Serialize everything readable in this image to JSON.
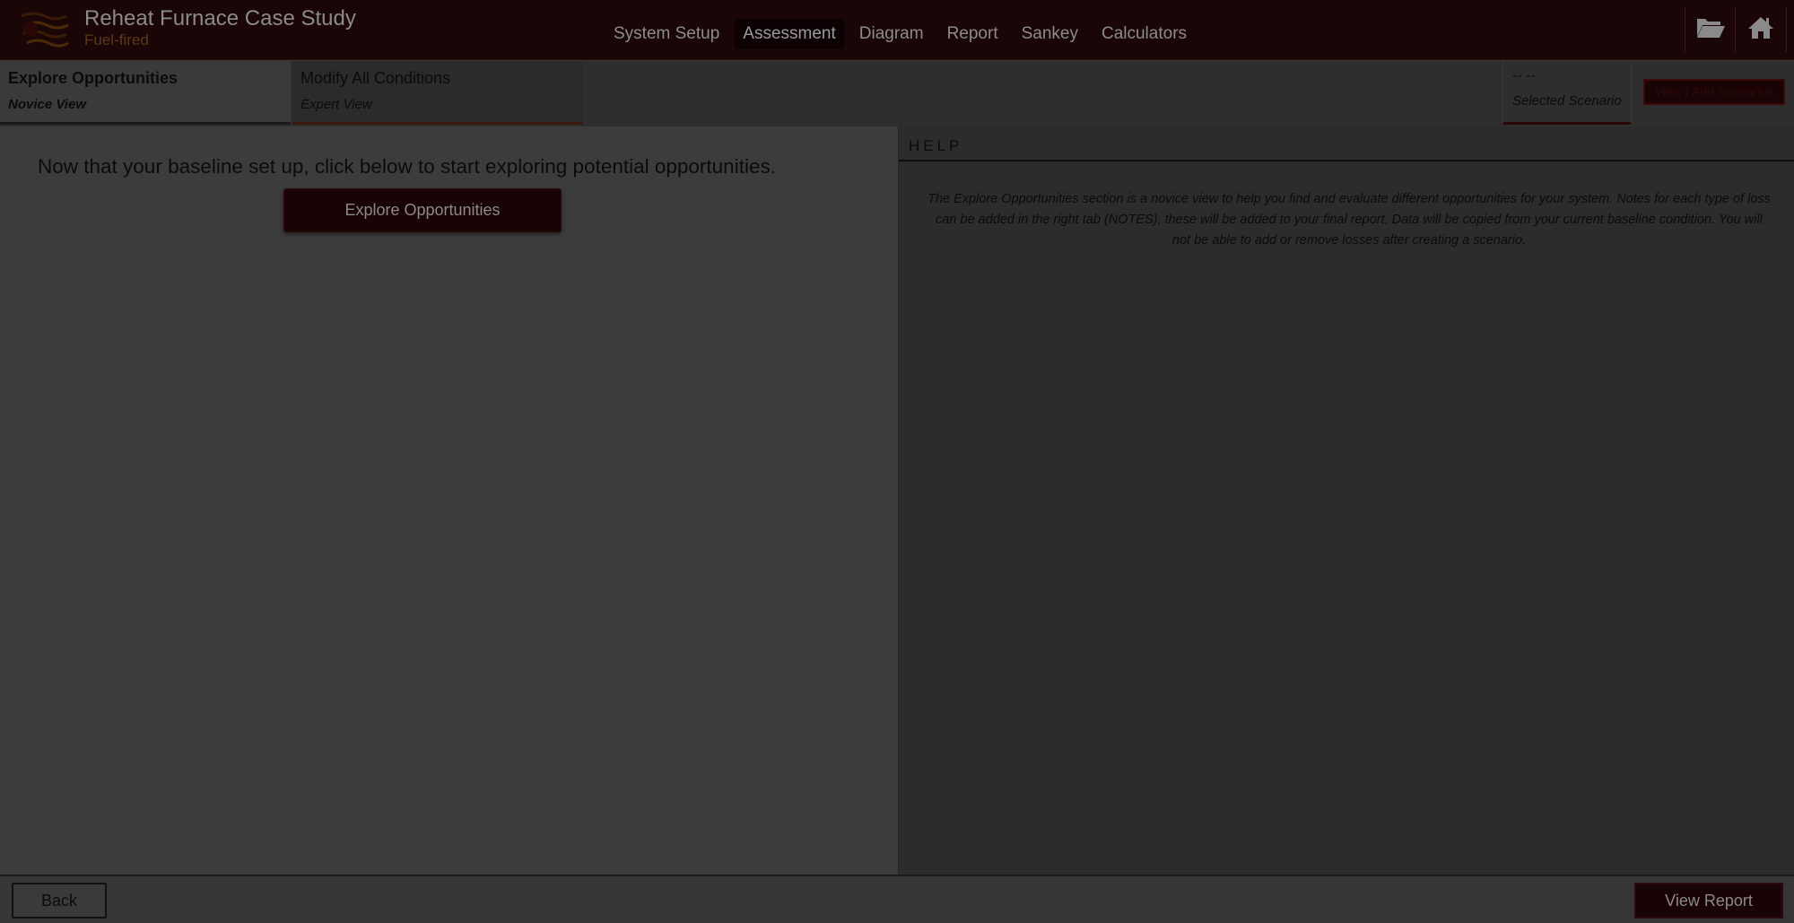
{
  "header": {
    "title": "Reheat Furnace Case Study",
    "subtitle": "Fuel-fired",
    "nav": [
      {
        "label": "System Setup"
      },
      {
        "label": "Assessment"
      },
      {
        "label": "Diagram"
      },
      {
        "label": "Report"
      },
      {
        "label": "Sankey"
      },
      {
        "label": "Calculators"
      }
    ],
    "active_nav": "Assessment",
    "icons": [
      "folder-open-icon",
      "home-icon"
    ]
  },
  "view_tabs": [
    {
      "title": "Explore Opportunities",
      "subtitle": "Novice View",
      "active": true
    },
    {
      "title": "Modify All Conditions",
      "subtitle": "Expert View",
      "active": false
    }
  ],
  "scenario": {
    "value": "-- --",
    "label": "Selected Scenario",
    "button_label": "View / Add Scenarios"
  },
  "main": {
    "intro_text": "Now that your baseline set up, click below to start exploring potential opportunities.",
    "explore_button": "Explore Opportunities"
  },
  "help": {
    "title": "HELP",
    "text": "The Explore Opportunities section is a novice view to help you find and evaluate different opportunities for your system. Notes for each type of loss can be added in the right tab (NOTES), these will be added to your final report. Data will be copied from your current baseline condition. You will not be able to add or remove losses after creating a scenario."
  },
  "footer": {
    "back_label": "Back",
    "report_label": "View Report"
  },
  "colors": {
    "header_bg": "#1a0507",
    "accent": "#1a0305",
    "panel_left": "#3c3c3c",
    "panel_right": "#2c2c2c"
  }
}
